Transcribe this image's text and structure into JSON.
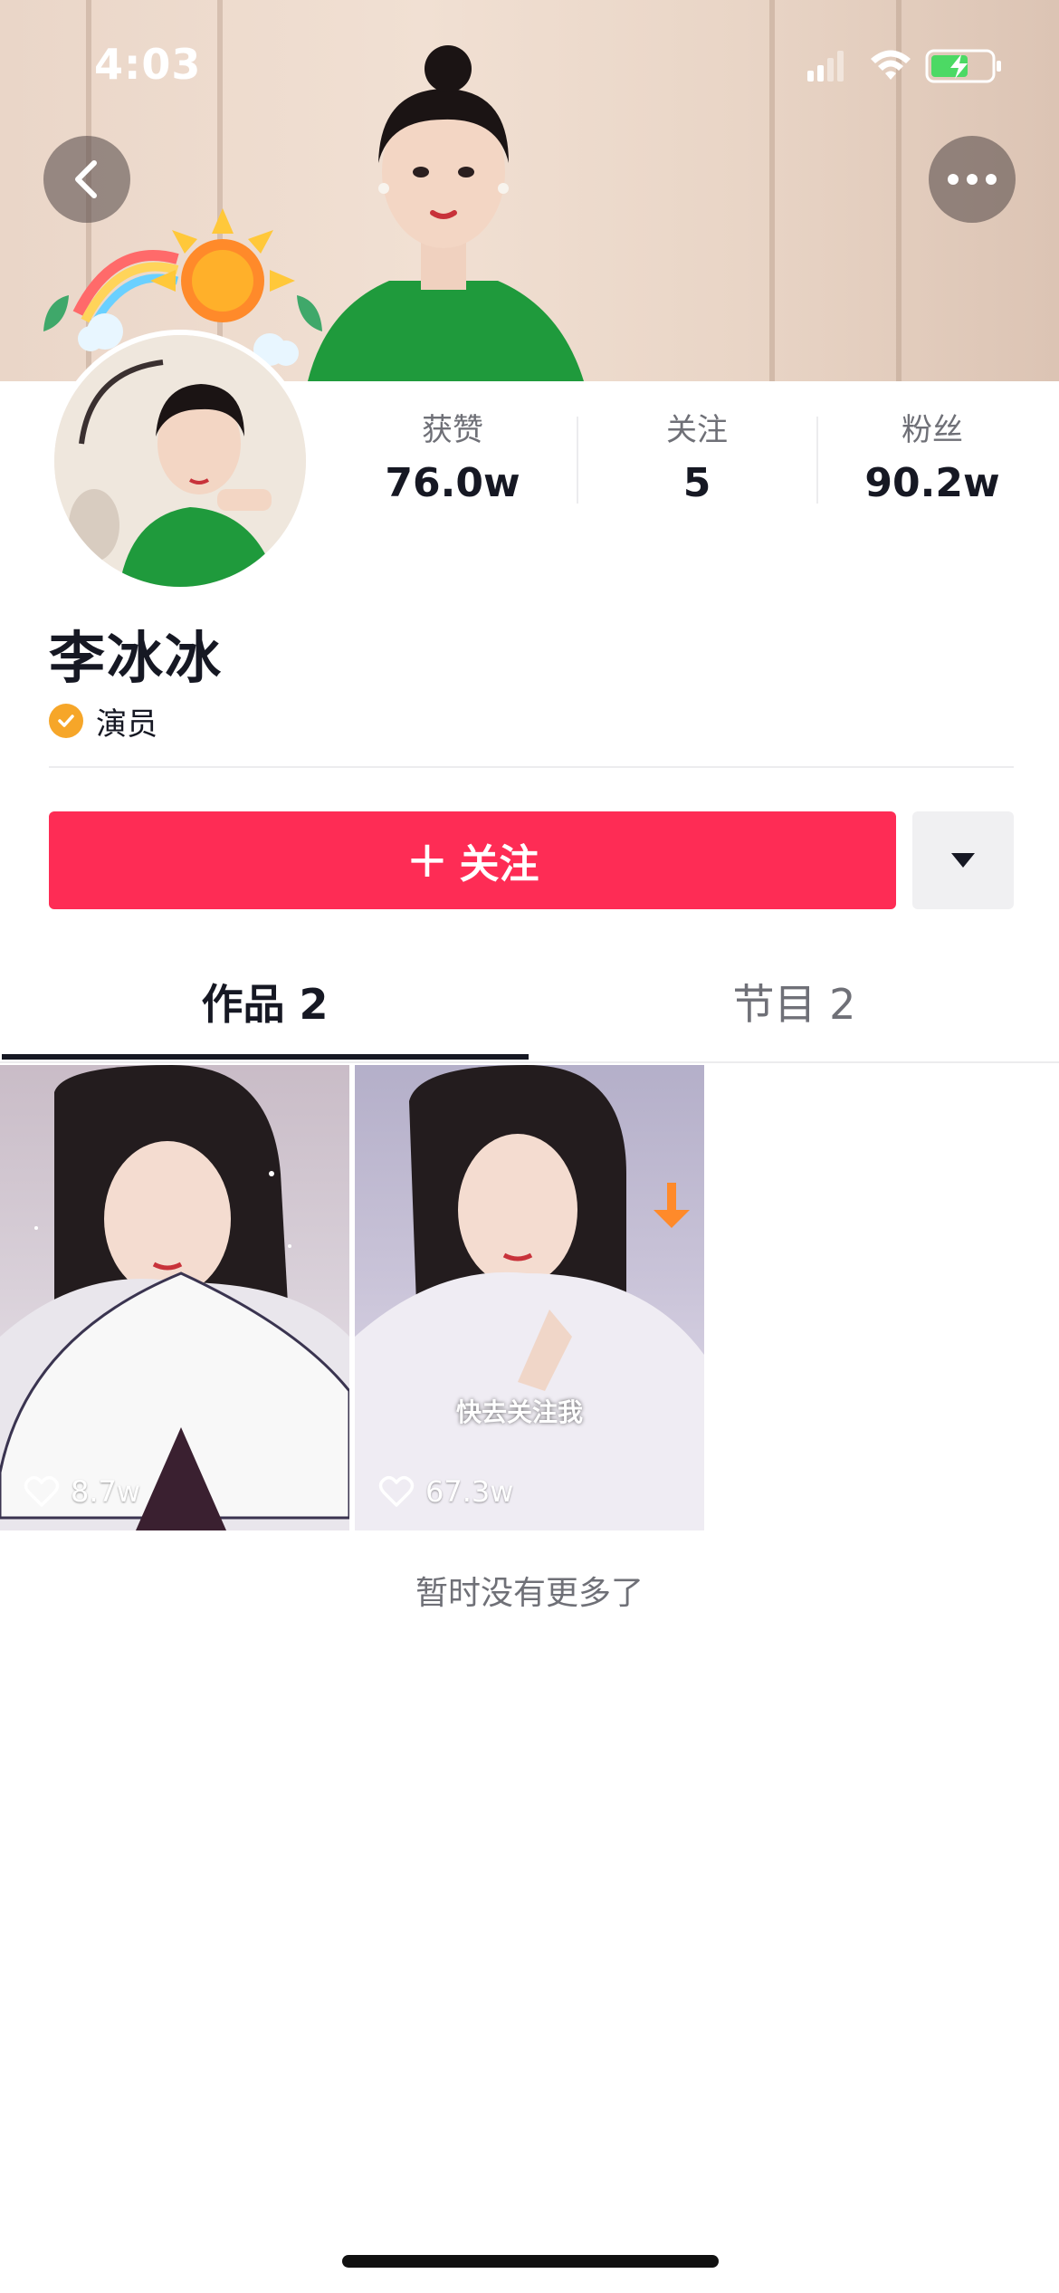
{
  "status_bar": {
    "time": "4:03"
  },
  "header": {
    "back_icon": "chevron-left-icon",
    "more_icon": "ellipsis-icon"
  },
  "profile": {
    "name": "李冰冰",
    "tag": "演员",
    "stats": [
      {
        "label": "获赞",
        "value": "76.0w"
      },
      {
        "label": "关注",
        "value": "5"
      },
      {
        "label": "粉丝",
        "value": "90.2w"
      }
    ]
  },
  "actions": {
    "follow_label": "关注",
    "follow_plus": "+",
    "dropdown_icon": "caret-down-icon"
  },
  "tabs": [
    {
      "label": "作品 2",
      "active": true
    },
    {
      "label": "节目 2",
      "active": false
    }
  ],
  "videos": [
    {
      "likes": "8.7w",
      "overlay_text": ""
    },
    {
      "likes": "67.3w",
      "overlay_text": "快去关注我"
    }
  ],
  "footer": {
    "no_more": "暂时没有更多了"
  },
  "colors": {
    "accent": "#fe2c55",
    "badge": "#f6a629",
    "text": "#161823",
    "secondary": "#6f7077"
  }
}
